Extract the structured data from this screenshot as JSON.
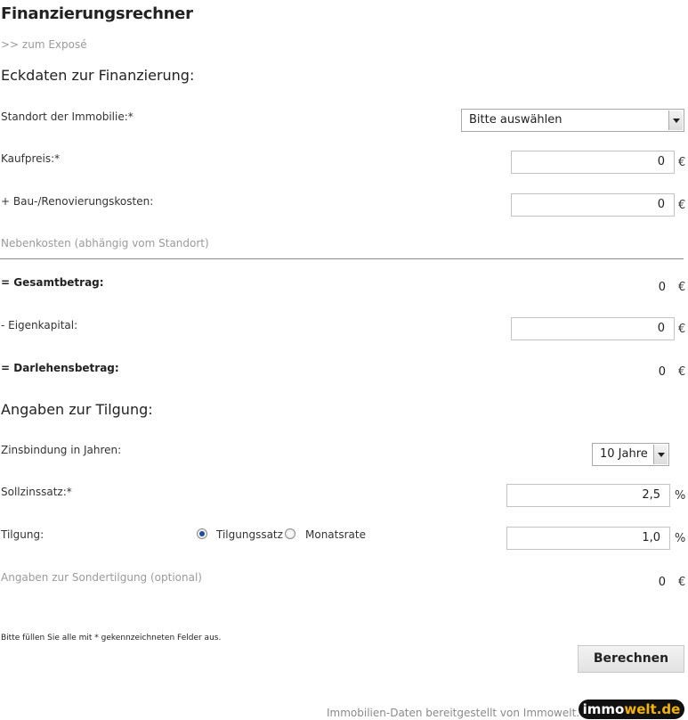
{
  "page": {
    "title": "Finanzierungsrechner",
    "back_link": ">> zum Exposé"
  },
  "eckdaten": {
    "heading": "Eckdaten zur Finanzierung:",
    "standort_label": "Standort der Immobilie:*",
    "standort_value": "Bitte auswählen",
    "kaufpreis_label": "Kaufpreis:*",
    "kaufpreis_value": "0",
    "bau_label": "+ Bau-/Renovierungskosten:",
    "bau_value": "0",
    "nebenkosten_label": "Nebenkosten (abhängig vom Standort)",
    "gesamt_label": "= Gesamtbetrag:",
    "gesamt_value": "0",
    "eigenkapital_label": "- Eigenkapital:",
    "eigenkapital_value": "0",
    "darlehen_label": "= Darlehensbetrag:",
    "darlehen_value": "0",
    "currency": "€"
  },
  "tilgung": {
    "heading": "Angaben zur Tilgung:",
    "zinsbindung_label": "Zinsbindung in Jahren:",
    "zinsbindung_value": "10 Jahre",
    "sollzins_label": "Sollzinssatz:*",
    "sollzins_value": "2,5",
    "tilgung_label": "Tilgung:",
    "option_tilgungssatz": "Tilgungssatz",
    "option_monatsrate": "Monatsrate",
    "selected_option": "Tilgungssatz",
    "tilgung_value": "1,0",
    "percent": "%",
    "sondertilgung_label": "Angaben zur Sondertilgung (optional)",
    "sondertilgung_value": "0",
    "currency": "€"
  },
  "footer": {
    "note": "Bitte füllen Sie alle mit * gekennzeichneten Felder aus.",
    "button": "Berechnen",
    "credit": "Immobilien-Daten bereitgestellt von Immowelt.de",
    "logo_part1": "immo",
    "logo_part2": "welt.de"
  },
  "colors": {
    "muted": "#9a9a9a",
    "radio_selected": "#1f4f9c",
    "logo_bg": "#111111",
    "logo_accent": "#f4b400"
  }
}
